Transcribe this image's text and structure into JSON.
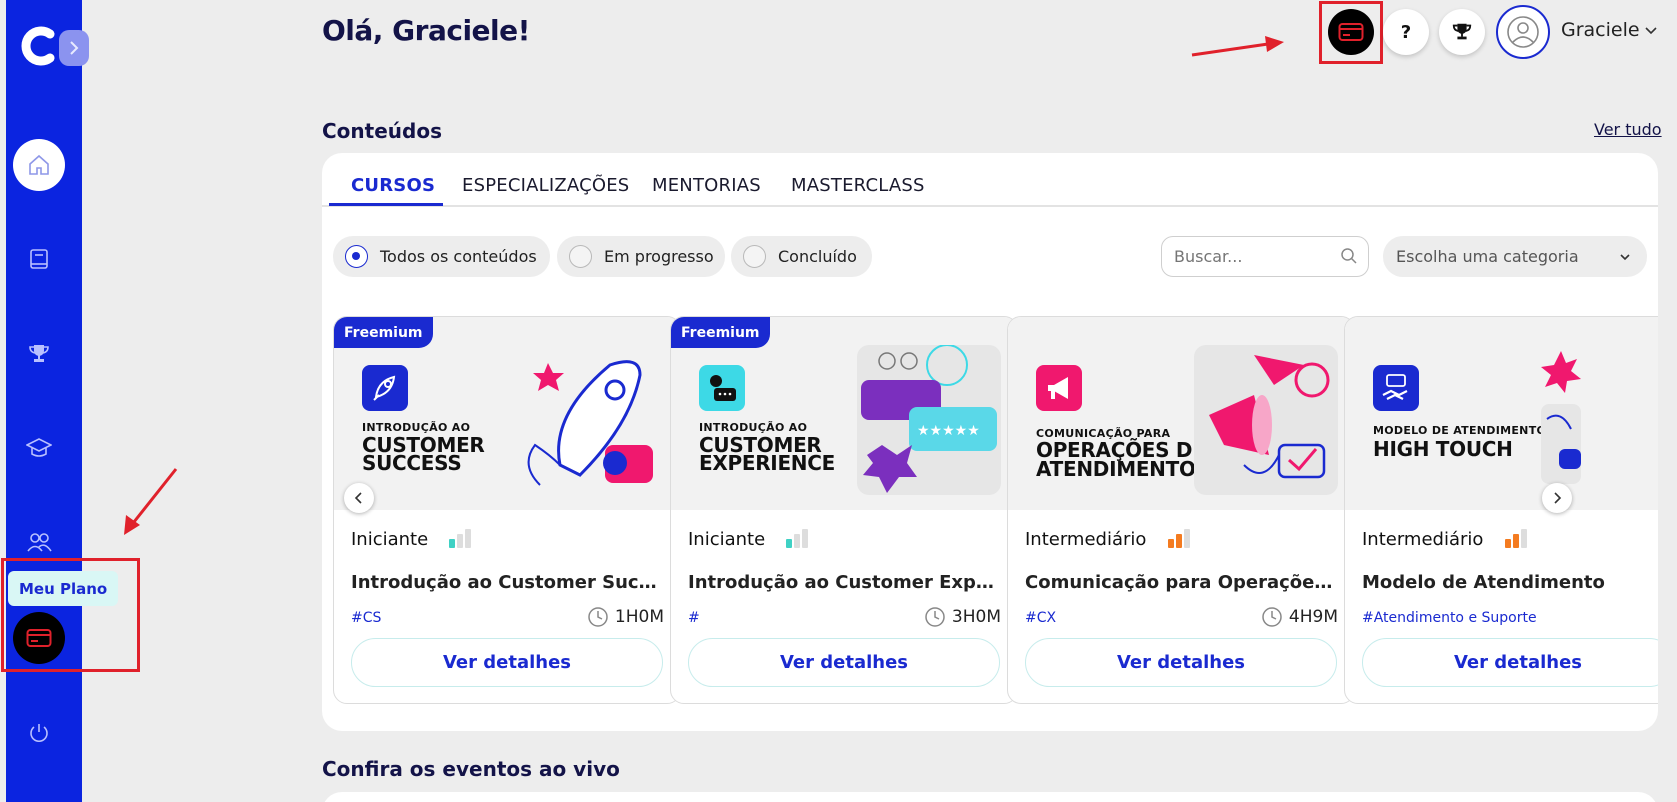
{
  "sidebar": {
    "tooltip": "Meu Plano",
    "icons": [
      "home-icon",
      "book-icon",
      "trophy-icon",
      "graduation-cap-icon",
      "people-icon",
      "credit-card-icon",
      "power-icon"
    ]
  },
  "header": {
    "greeting": "Olá, Graciele!",
    "help_label": "?",
    "user_name": "Graciele"
  },
  "contents": {
    "title": "Conteúdos",
    "see_all": "Ver tudo",
    "tabs": [
      "CURSOS",
      "ESPECIALIZAÇÕES",
      "MENTORIAS",
      "MASTERCLASS"
    ],
    "active_tab": "CURSOS",
    "filters": [
      "Todos os conteúdos",
      "Em progresso",
      "Concluído"
    ],
    "selected_filter": "Todos os conteúdos",
    "search_placeholder": "Buscar...",
    "category_placeholder": "Escolha uma categoria",
    "details_label": "Ver detalhes",
    "cards": [
      {
        "badge": "Freemium",
        "cover_small": "INTRODUÇÃO AO",
        "cover_big_1": "CUSTOMER",
        "cover_big_2": "SUCCESS",
        "level": "Iniciante",
        "title": "Introdução ao Customer Success",
        "tag": "#CS",
        "duration": "1H0M"
      },
      {
        "badge": "Freemium",
        "cover_small": "INTRODUÇÃO AO",
        "cover_big_1": "CUSTOMER",
        "cover_big_2": "EXPERIENCE",
        "level": "Iniciante",
        "title": "Introdução ao Customer Experi...",
        "tag": "#",
        "duration": "3H0M"
      },
      {
        "badge": "",
        "cover_small": "COMUNICAÇÃO PARA",
        "cover_big_1": "OPERAÇÕES DE",
        "cover_big_2": "ATENDIMENTO",
        "level": "Intermediário",
        "title": "Comunicação para Operações ...",
        "tag": "#CX",
        "duration": "4H9M"
      },
      {
        "badge": "",
        "cover_small": "MODELO DE ATENDIMENTO:",
        "cover_big_1": "HIGH TOUCH",
        "cover_big_2": "",
        "level": "Intermediário",
        "title": "Modelo de Atendimento",
        "tag": "#Atendimento e Suporte",
        "duration": ""
      }
    ]
  },
  "events": {
    "title": "Confira os eventos ao vivo"
  },
  "colors": {
    "sidebar": "#0b24e0",
    "accent": "#1a2ad0",
    "highlight": "#e0212b",
    "beginner_level": "#3fd1c4",
    "intermediate_level": "#f47b20"
  }
}
